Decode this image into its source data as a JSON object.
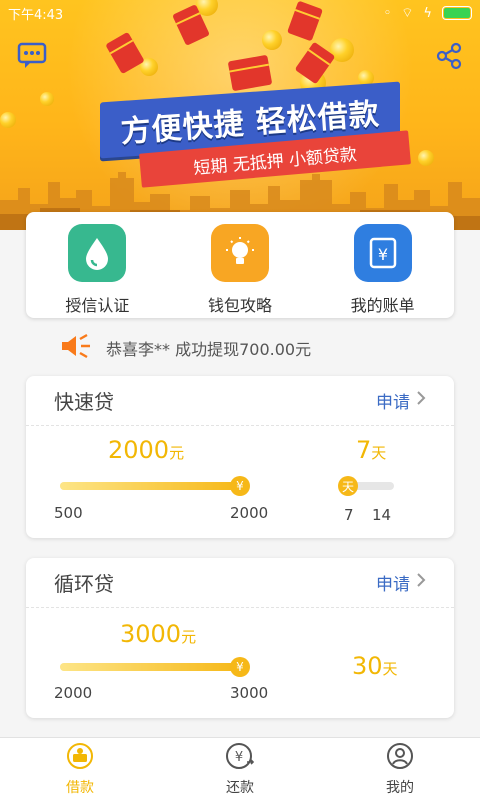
{
  "status_bar": {
    "time": "下午4:43"
  },
  "banner": {
    "headline": "方便快捷  轻松借款",
    "ribbon": "短期  无抵押  小额贷款",
    "icons": [
      "chat-icon",
      "share-icon"
    ]
  },
  "menu": [
    {
      "label": "授信认证",
      "icon": "drop-icon",
      "color": "#37b88f"
    },
    {
      "label": "钱包攻略",
      "icon": "lightbulb-icon",
      "color": "#f8a623"
    },
    {
      "label": "我的账单",
      "icon": "bill-icon",
      "color": "#2f7ee0"
    }
  ],
  "notice": {
    "text": "恭喜李** 成功提现700.00元",
    "icon": "speaker-icon"
  },
  "loans": [
    {
      "title": "快速贷",
      "apply_label": "申请",
      "amount_value": "2000",
      "amount_unit": "元",
      "amount_min": "500",
      "amount_max": "2000",
      "amount_level": 1.0,
      "knob_symbol": "¥",
      "days_value": "7",
      "days_unit": "天",
      "days_min": "7",
      "days_max": "14",
      "days_level": 0.0,
      "days_knob_symbol": "天"
    },
    {
      "title": "循环贷",
      "apply_label": "申请",
      "amount_value": "3000",
      "amount_unit": "元",
      "amount_min": "2000",
      "amount_max": "3000",
      "amount_level": 1.0,
      "knob_symbol": "¥",
      "days_value": "30",
      "days_unit": "天"
    }
  ],
  "bottom_nav": [
    {
      "label": "借款",
      "icon": "loan-icon",
      "active": true
    },
    {
      "label": "还款",
      "icon": "repay-icon",
      "active": false
    },
    {
      "label": "我的",
      "icon": "profile-icon",
      "active": false
    }
  ],
  "colors": {
    "accent": "#f2b705",
    "link": "#3b6bc4",
    "banner": "#ffc41f"
  }
}
